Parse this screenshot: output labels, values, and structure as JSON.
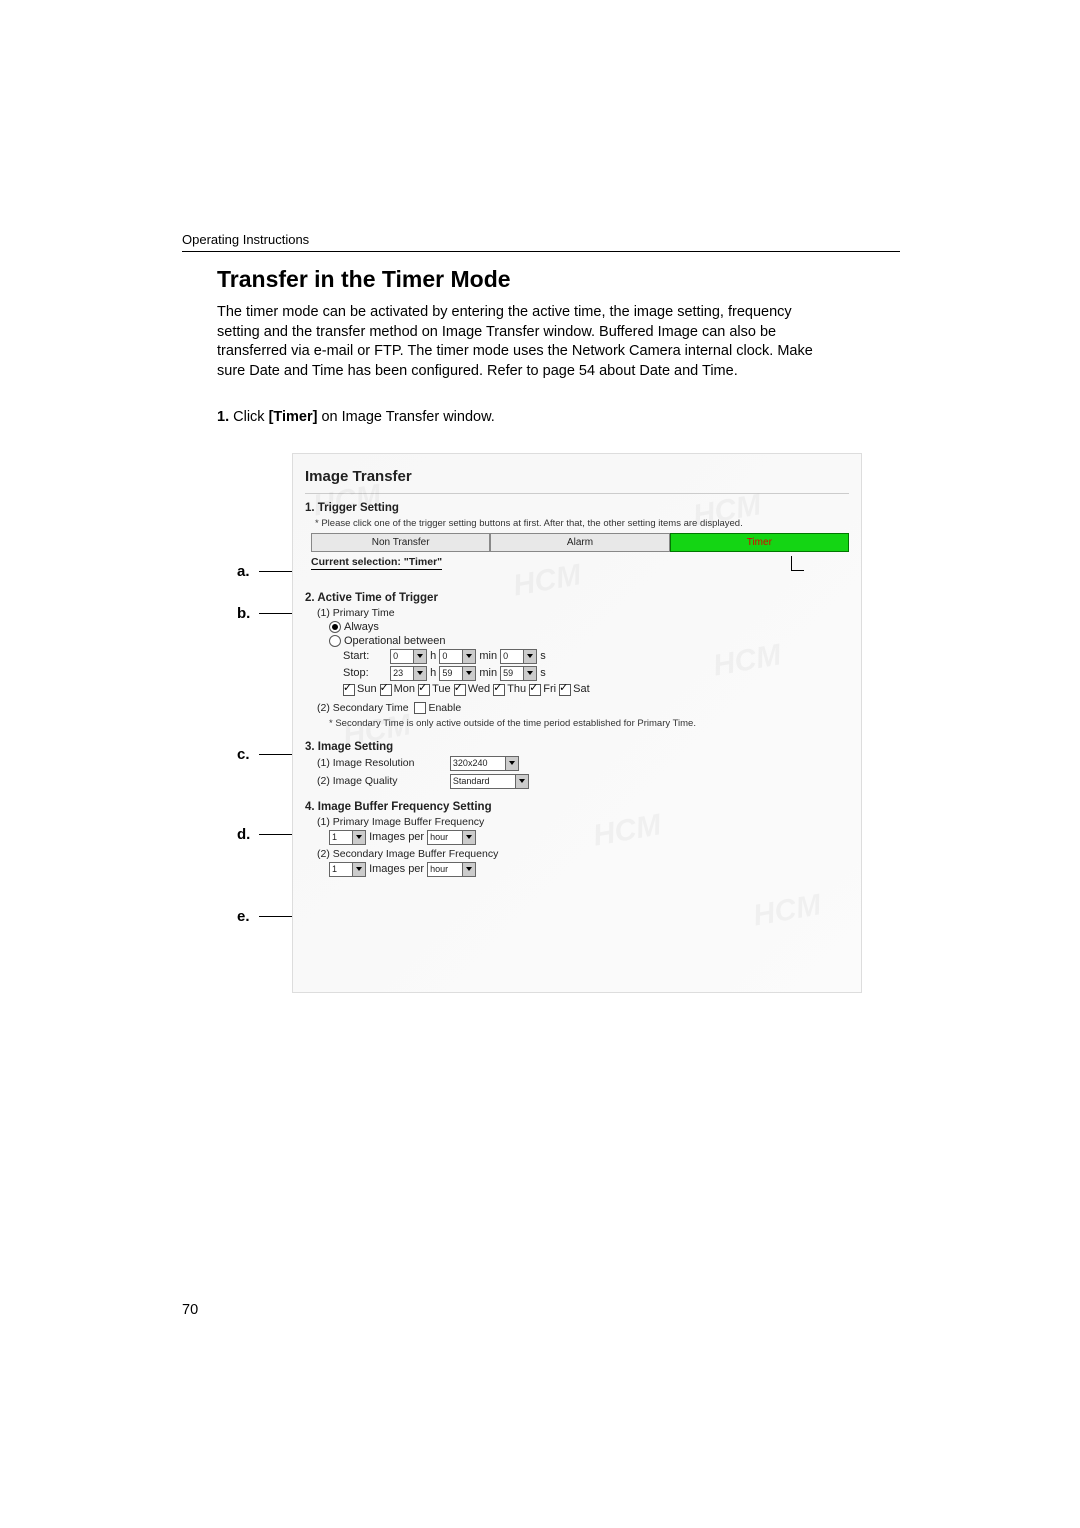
{
  "header": "Operating Instructions",
  "title": "Transfer in the Timer Mode",
  "paragraph": "The timer mode can be activated by entering the active time, the image setting, frequency setting and the transfer method on Image Transfer window. Buffered Image can also be transferred via e-mail or FTP. The timer mode uses the Network Camera internal clock. Make sure Date and Time has been configured. Refer to page 54 about Date and Time.",
  "step_num": "1.",
  "step_text_1": "Click ",
  "step_bold": "[Timer]",
  "step_text_2": " on Image Transfer window.",
  "labels": {
    "a": "a.",
    "b": "b.",
    "c": "c.",
    "d": "d.",
    "e": "e."
  },
  "shot": {
    "title": "Image Transfer",
    "s1": "1.  Trigger Setting",
    "s1_note": "* Please click one of the trigger setting buttons at first. After that, the other setting items are displayed.",
    "btn_non": "Non Transfer",
    "btn_alarm": "Alarm",
    "btn_timer": "Timer",
    "current": "Current selection: \"Timer\"",
    "s2": "2.  Active Time of Trigger",
    "s2_1": "(1)  Primary Time",
    "always": "Always",
    "opbetween": "Operational between",
    "start": "Start:",
    "stop": "Stop:",
    "start_h": "0",
    "start_m": "0",
    "start_s": "0",
    "stop_h": "23",
    "stop_m": "59",
    "stop_s": "59",
    "h": "h",
    "min": "min",
    "s": "s",
    "days": [
      "Sun",
      "Mon",
      "Tue",
      "Wed",
      "Thu",
      "Fri",
      "Sat"
    ],
    "s2_2": "(2)  Secondary Time",
    "enable": "Enable",
    "s2_2_note": "* Secondary Time is only active outside of the time period established for Primary Time.",
    "s3": "3.  Image Setting",
    "s3_1": "(1)  Image Resolution",
    "res": "320x240",
    "s3_2": "(2)  Image Quality",
    "qual": "Standard",
    "s4": "4.  Image Buffer Frequency Setting",
    "s4_1": "(1)  Primary Image Buffer Frequency",
    "s4_2": "(2)  Secondary Image Buffer Frequency",
    "freq_n": "1",
    "freq_text": "Images per",
    "freq_unit": "hour"
  },
  "pagenum": "70"
}
